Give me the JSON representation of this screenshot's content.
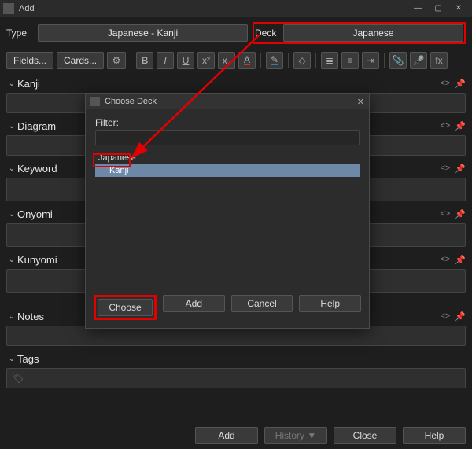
{
  "window": {
    "title": "Add",
    "min_icon": "—",
    "max_icon": "▢",
    "close_icon": "✕"
  },
  "top": {
    "type_label": "Type",
    "type_value": "Japanese - Kanji",
    "deck_label": "Deck",
    "deck_value": "Japanese"
  },
  "toolbar": {
    "fields": "Fields...",
    "cards": "Cards...",
    "gear": "⚙",
    "bold": "B",
    "italic": "I",
    "underline": "U",
    "super": "x²",
    "sub": "x₂",
    "fontcolor": "A",
    "highlight": "✎",
    "erase": "◇",
    "ul": "≣",
    "ol": "≡",
    "indent": "⇥",
    "clip": "📎",
    "mic": "🎤",
    "fx": "fx"
  },
  "fields": [
    {
      "name": "Kanji"
    },
    {
      "name": "Diagram"
    },
    {
      "name": "Keyword"
    },
    {
      "name": "Onyomi"
    },
    {
      "name": "Kunyomi"
    },
    {
      "name": "Notes"
    }
  ],
  "tags": {
    "label": "Tags",
    "icon": "🏷"
  },
  "field_icons": {
    "code": "<>",
    "pin": "📌"
  },
  "bottom": {
    "add": "Add",
    "history": "History ▼",
    "close": "Close",
    "help": "Help"
  },
  "dialog": {
    "title": "Choose Deck",
    "close": "✕",
    "filter_label": "Filter:",
    "items": [
      {
        "name": "Japanese",
        "indent": 0,
        "selected": false
      },
      {
        "name": "Kanji",
        "indent": 1,
        "selected": true
      }
    ],
    "buttons": {
      "choose": "Choose",
      "add": "Add",
      "cancel": "Cancel",
      "help": "Help"
    }
  }
}
